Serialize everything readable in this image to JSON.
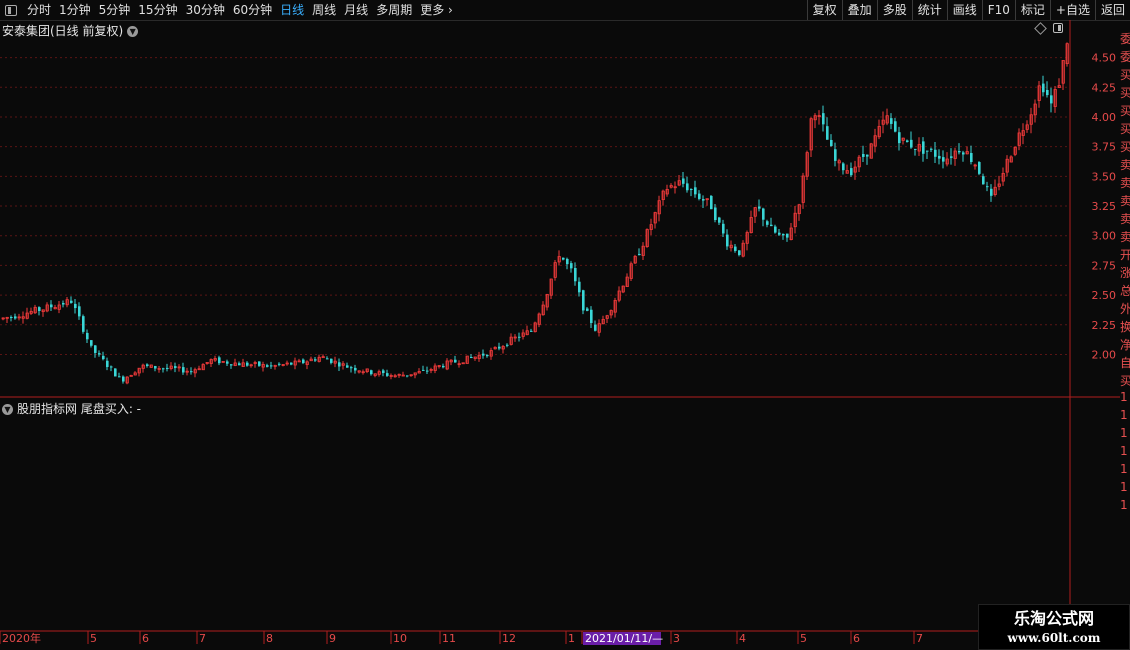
{
  "toolbar": {
    "periods": [
      "分时",
      "1分钟",
      "5分钟",
      "15分钟",
      "30分钟",
      "60分钟",
      "日线",
      "周线",
      "月线",
      "多周期",
      "更多 ›"
    ],
    "active_period": "日线",
    "right_buttons": [
      "复权",
      "叠加",
      "多股",
      "统计",
      "画线",
      "F10",
      "标记",
      "+自选",
      "返回"
    ]
  },
  "chart": {
    "title": "安泰集团(日线 前复权)",
    "indicator_title": "股朋指标网  尾盘买入: -"
  },
  "right_panel_chars": [
    "委",
    "委",
    "买",
    "买",
    "买",
    "买",
    "买",
    "卖",
    "卖",
    "卖",
    "卖",
    "卖",
    "开",
    "涨",
    "总",
    "外",
    "换",
    "净",
    "自",
    "买",
    "1",
    "1",
    "1",
    "1",
    "1",
    "1",
    "1"
  ],
  "watermark": {
    "title": "乐淘公式网",
    "url": "www.60lt.com"
  },
  "colors": {
    "up": "#f03a3a",
    "down": "#3ad6d6",
    "grid": "#5a1414",
    "axis": "#b01e1e",
    "highlight": "#6a1ea8"
  },
  "chart_data": {
    "type": "candlestick",
    "title": "安泰集团(日线 前复权)",
    "ylim": [
      1.65,
      4.8
    ],
    "y_ticks": [
      2.0,
      2.25,
      2.5,
      2.75,
      3.0,
      3.25,
      3.5,
      3.75,
      4.0,
      4.25,
      4.5
    ],
    "y_tick_labels": [
      "2.00",
      "2.25",
      "2.50",
      "2.75",
      "3.00",
      "3.25",
      "3.50",
      "3.75",
      "4.00",
      "4.25",
      "4.50"
    ],
    "x_labels": [
      "2020年",
      "5",
      "6",
      "7",
      "8",
      "9",
      "10",
      "11",
      "12",
      "1",
      "2021/01/11/—",
      "3",
      "4",
      "5",
      "6",
      "7"
    ],
    "highlight_label": "2021/01/11/—",
    "close_series": [
      [
        0,
        2.3
      ],
      [
        40,
        2.38
      ],
      [
        70,
        2.45
      ],
      [
        78,
        2.3
      ],
      [
        90,
        2.05
      ],
      [
        105,
        1.92
      ],
      [
        120,
        1.78
      ],
      [
        140,
        1.9
      ],
      [
        170,
        1.88
      ],
      [
        190,
        1.86
      ],
      [
        210,
        1.95
      ],
      [
        240,
        1.92
      ],
      [
        270,
        1.9
      ],
      [
        300,
        1.93
      ],
      [
        320,
        1.98
      ],
      [
        345,
        1.9
      ],
      [
        370,
        1.85
      ],
      [
        395,
        1.82
      ],
      [
        420,
        1.85
      ],
      [
        445,
        1.92
      ],
      [
        470,
        1.97
      ],
      [
        490,
        2.02
      ],
      [
        510,
        2.12
      ],
      [
        530,
        2.2
      ],
      [
        545,
        2.5
      ],
      [
        558,
        2.85
      ],
      [
        570,
        2.7
      ],
      [
        582,
        2.4
      ],
      [
        595,
        2.2
      ],
      [
        610,
        2.4
      ],
      [
        625,
        2.65
      ],
      [
        640,
        2.9
      ],
      [
        655,
        3.2
      ],
      [
        665,
        3.4
      ],
      [
        680,
        3.45
      ],
      [
        695,
        3.35
      ],
      [
        710,
        3.25
      ],
      [
        725,
        2.95
      ],
      [
        740,
        2.85
      ],
      [
        755,
        3.25
      ],
      [
        770,
        3.05
      ],
      [
        785,
        2.95
      ],
      [
        800,
        3.35
      ],
      [
        812,
        4.1
      ],
      [
        822,
        3.9
      ],
      [
        835,
        3.6
      ],
      [
        850,
        3.55
      ],
      [
        870,
        3.75
      ],
      [
        885,
        4.0
      ],
      [
        900,
        3.8
      ],
      [
        915,
        3.75
      ],
      [
        930,
        3.7
      ],
      [
        945,
        3.65
      ],
      [
        960,
        3.75
      ],
      [
        975,
        3.6
      ],
      [
        990,
        3.3
      ],
      [
        1000,
        3.5
      ],
      [
        1015,
        3.8
      ],
      [
        1030,
        4.05
      ],
      [
        1040,
        4.3
      ],
      [
        1050,
        4.1
      ],
      [
        1060,
        4.35
      ],
      [
        1066,
        4.65
      ],
      [
        1069,
        4.42
      ]
    ]
  }
}
